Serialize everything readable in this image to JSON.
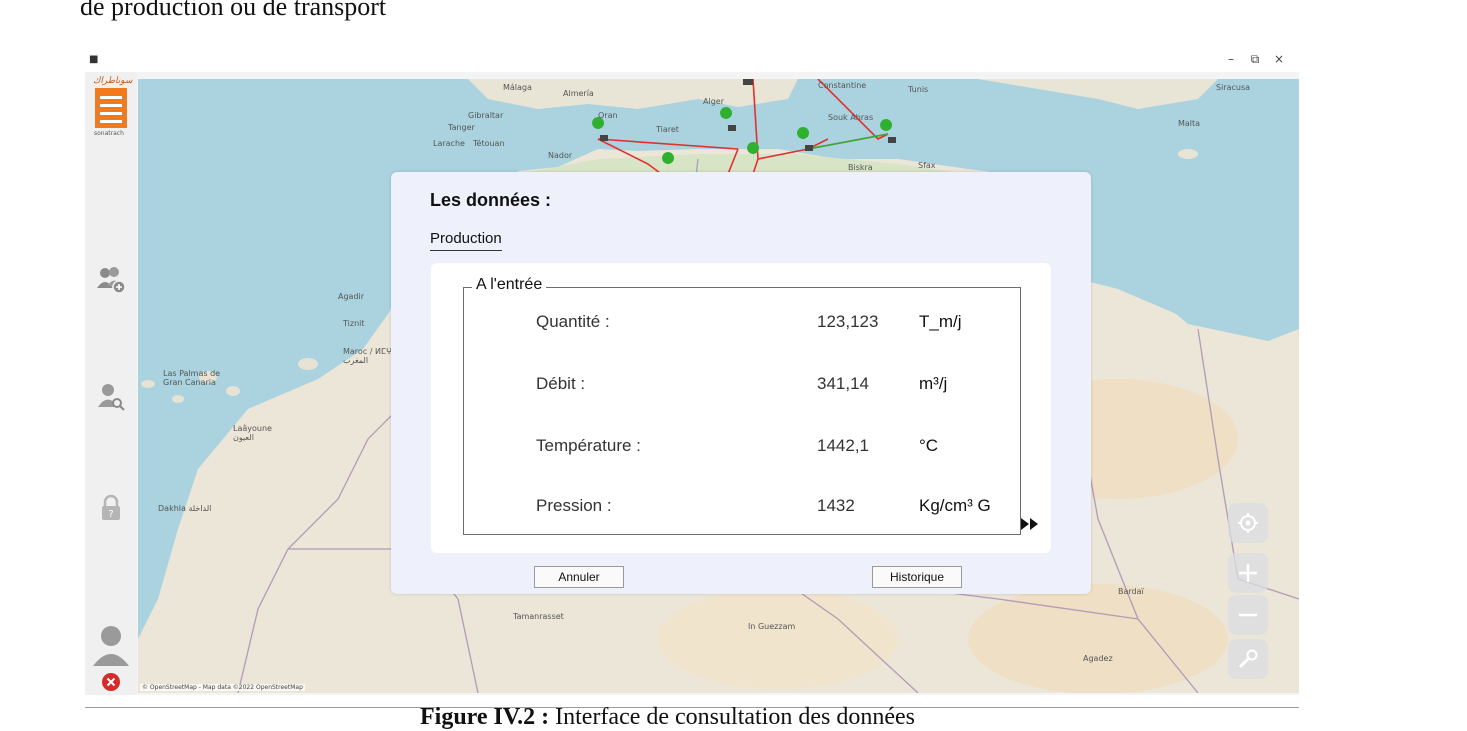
{
  "document": {
    "top_text": "de production ou de transport",
    "caption_bold": "Figure IV.2 : ",
    "caption_rest": "Interface de consultation des données"
  },
  "window": {
    "controls": {
      "minimize": "–",
      "maximize": "⧉",
      "close": "×"
    }
  },
  "sidebar": {
    "logo_script": "سوناطراك",
    "logo_name": "sonatrach",
    "items": [
      {
        "icon": "add-user-icon"
      },
      {
        "icon": "search-user-icon"
      },
      {
        "icon": "lock-icon"
      },
      {
        "icon": "user-avatar-icon"
      },
      {
        "icon": "logout-icon"
      }
    ]
  },
  "map": {
    "attribution": "© OpenStreetMap - Map data ©2022 OpenStreetMap",
    "labels": [
      "Málaga",
      "Almería",
      "Gibraltar",
      "Oran",
      "Alger",
      "Constantine",
      "Tunis",
      "Malta",
      "Siracusa",
      "Souk Ahras",
      "Tiaret",
      "Biskra",
      "Sfax",
      "Nador",
      "Larache",
      "Tétouan",
      "Tanger",
      "Agadir",
      "Tiznit",
      "Maroc / ⵍⵎⵖⵔⵉⴱ / المغرب",
      "Las Palmas de Gran Canaria",
      "Laâyoune العيون",
      "Dakhla الداخلة",
      "Bardaï",
      "Agadez",
      "Tamanrasset",
      "In Guezzam"
    ],
    "controls": [
      "locate-icon",
      "zoom-in-icon",
      "zoom-out-icon",
      "tools-icon"
    ]
  },
  "dialog": {
    "title": "Les données :",
    "tab": "Production",
    "section": "A l'entrée",
    "rows": [
      {
        "label": "Quantité :",
        "value": "123,123",
        "unit": "T_m/j"
      },
      {
        "label": "Débit :",
        "value": "341,14",
        "unit": "m³/j"
      },
      {
        "label": "Température :",
        "value": "1442,1",
        "unit": "°C"
      },
      {
        "label": "Pression :",
        "value": "1432",
        "unit": "Kg/cm³ G"
      }
    ],
    "cancel": "Annuler",
    "history": "Historique"
  }
}
